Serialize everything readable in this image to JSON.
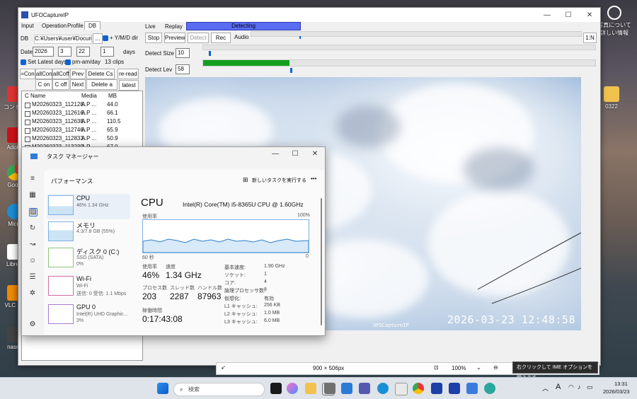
{
  "desktop": {
    "icons_left": [
      "コントロ",
      "Adobe",
      "Googl",
      "Micro",
      "LibreO",
      "VLC me",
      "nasne"
    ],
    "icons_right": [
      {
        "label": "写真について\n詳しい情報"
      },
      {
        "label": "0322"
      }
    ]
  },
  "ufo": {
    "title": "UFOCaptureIP",
    "tabs": [
      "Input",
      "Operation",
      "Profile",
      "DB"
    ],
    "db_label": "DB",
    "db_path": "C:¥Users¥user¥Document",
    "browse_label": "...",
    "ymd_dir_label": "+ Y/M/D dir",
    "date_label": "Date",
    "date_year": "2026",
    "date_month": "3",
    "date_day": "22",
    "days_value": "1",
    "days_label": "days",
    "set_latest_days_label": "Set Latest days",
    "pm_am_day_label": "pm-am/day",
    "clips_count": "13 clips",
    "buttons_row1": [
      "=Con",
      "allCon",
      "allCoff",
      "Prev",
      "Delete Cs",
      "re-read"
    ],
    "buttons_row2": [
      "C on",
      "C off",
      "Next",
      "Delete a clip",
      "latest"
    ],
    "list_headers": [
      "C",
      "Name",
      "Media",
      "MB"
    ],
    "clips": [
      {
        "name": "M20260323_112128...",
        "media": "A  P  ...",
        "mb": "44.0"
      },
      {
        "name": "M20260323_112616...",
        "media": "A  P  ...",
        "mb": "66.1"
      },
      {
        "name": "M20260323_112638...",
        "media": "A  P  ...",
        "mb": "110.5"
      },
      {
        "name": "M20260323_112746...",
        "media": "A  P  ...",
        "mb": "65.9"
      },
      {
        "name": "M20260323_112833...",
        "media": "A  P  ...",
        "mb": "50.9"
      },
      {
        "name": "M20260323_113239...",
        "media": "A  P  ...",
        "mb": "67.0"
      }
    ],
    "live_label": "Live",
    "replay_label": "Replay",
    "detecting_label": "Detecting",
    "stop_label": "Stop",
    "preview_label": "Preview",
    "detect_label": "Detect",
    "rec_label": "Rec",
    "audio_label": "Audio",
    "ratio_label": "1:N",
    "detect_size_label": "Detect Size",
    "detect_size_value": "10",
    "detect_lev_label": "Detect Lev",
    "detect_lev_value": "58",
    "detect_lev_fill": 0.22,
    "timestamp": "2026-03-23  12:48:58",
    "watermark": "UFOCaptureIP"
  },
  "taskmgr": {
    "title": "タスク マネージャー",
    "section": "パフォーマンス",
    "run_new_task": "新しいタスクを実行する",
    "more": "•••",
    "items": [
      {
        "name": "CPU",
        "l2": "46%  1.34 GHz",
        "l3": ""
      },
      {
        "name": "メモリ",
        "l2": "4.3/7.8 GB (55%)",
        "l3": ""
      },
      {
        "name": "ディスク 0 (C:)",
        "l2": "SSD (SATA)",
        "l3": "0%"
      },
      {
        "name": "Wi-Fi",
        "l2": "Wi-Fi",
        "l3": "送信: 0 受信: 1.1 Mbps"
      },
      {
        "name": "GPU 0",
        "l2": "Intel(R) UHD Graphic...",
        "l3": "3%"
      }
    ],
    "cpu_title": "CPU",
    "cpu_model": "Intel(R) Core(TM) i5-8365U CPU @ 1.60GHz",
    "usage_rate_label": "使用率",
    "pct100": "100%",
    "seconds60": "60 秒",
    "zero": "0",
    "util_label": "使用率",
    "util_value": "46%",
    "speed_label": "速度",
    "speed_value": "1.34 GHz",
    "proc_label": "プロセス数",
    "proc_value": "203",
    "thread_label": "スレッド数",
    "thread_value": "2287",
    "handle_label": "ハンドル数",
    "handle_value": "87963",
    "uptime_label": "稼働時間",
    "uptime_value": "0:17:43:08",
    "specs": [
      {
        "k": "基本速度:",
        "v": "1.90 GHz"
      },
      {
        "k": "ソケット:",
        "v": "1"
      },
      {
        "k": "コア:",
        "v": "4"
      },
      {
        "k": "論理プロセッサ数:",
        "v": "8"
      },
      {
        "k": "仮想化:",
        "v": "有効"
      },
      {
        "k": "L1 キャッシュ:",
        "v": "256 KB"
      },
      {
        "k": "L2 キャッシュ:",
        "v": "1.0 MB"
      },
      {
        "k": "L3 キャッシュ:",
        "v": "6.0 MB"
      }
    ]
  },
  "statusbar": {
    "image_size": "900 × 506px",
    "zoom": "100%",
    "tooltip": "右クリックして IME オプションを開きます"
  },
  "taskbar": {
    "search_placeholder": "検索",
    "ime_label": "A",
    "time": "13:31",
    "date": "2026/03/23"
  }
}
